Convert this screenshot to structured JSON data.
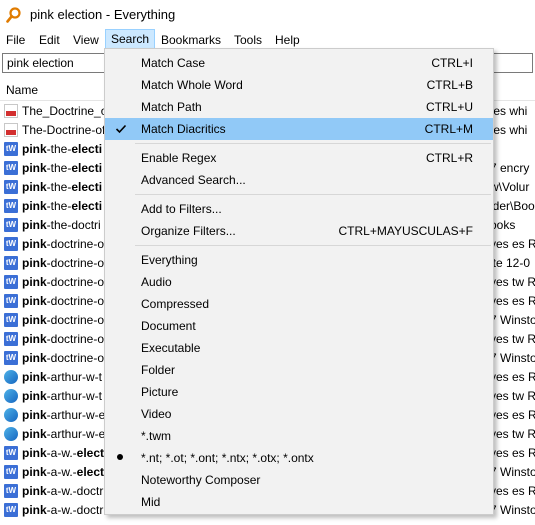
{
  "window": {
    "title": "pink election - Everything"
  },
  "menubar": [
    "File",
    "Edit",
    "View",
    "Search",
    "Bookmarks",
    "Tools",
    "Help"
  ],
  "search": {
    "value": "pink election"
  },
  "list": {
    "column_name": "Name",
    "rows": [
      {
        "icon": "pdf-icon",
        "bold": "",
        "rest": "The_Doctrine_of",
        "right": "tes whi"
      },
      {
        "icon": "pdf-icon",
        "bold": "",
        "rest": "The-Doctrine-of",
        "right": "tes whi"
      },
      {
        "icon": "tw-icon",
        "bold": "pink",
        "rest": "-the-",
        "bold2": "electi",
        "right": ""
      },
      {
        "icon": "tw-icon",
        "bold": "pink",
        "rest": "-the-",
        "bold2": "electi",
        "right": "7 encry"
      },
      {
        "icon": "tw-icon",
        "bold": "pink",
        "rest": "-the-",
        "bold2": "electi",
        "right": "w\\Volur"
      },
      {
        "icon": "tw-icon",
        "bold": "pink",
        "rest": "-the-",
        "bold2": "electi",
        "right": "lder\\Boo"
      },
      {
        "icon": "tw-icon",
        "bold": "pink",
        "rest": "-the-doctri",
        "bold2": "",
        "right": "ooks"
      },
      {
        "icon": "tw-icon",
        "bold": "pink",
        "rest": "-doctrine-o",
        "bold2": "",
        "right": "ves es R"
      },
      {
        "icon": "tw-icon",
        "bold": "pink",
        "rest": "-doctrine-o",
        "bold2": "",
        "right": "ite 12-0"
      },
      {
        "icon": "tw-icon",
        "bold": "pink",
        "rest": "-doctrine-o",
        "bold2": "",
        "right": "ves tw R"
      },
      {
        "icon": "tw-icon",
        "bold": "pink",
        "rest": "-doctrine-o",
        "bold2": "",
        "right": "ves es R"
      },
      {
        "icon": "tw-icon",
        "bold": "pink",
        "rest": "-doctrine-o",
        "bold2": "",
        "right": "7 Winsto"
      },
      {
        "icon": "tw-icon",
        "bold": "pink",
        "rest": "-doctrine-o",
        "bold2": "",
        "right": "ves tw R"
      },
      {
        "icon": "tw-icon",
        "bold": "pink",
        "rest": "-doctrine-o",
        "bold2": "",
        "right": "7 Winsto"
      },
      {
        "icon": "edge-icon",
        "bold": "pink",
        "rest": "-arthur-w-t",
        "bold2": "",
        "right": "ves es R"
      },
      {
        "icon": "edge-icon",
        "bold": "pink",
        "rest": "-arthur-w-t",
        "bold2": "",
        "right": "ves tw R"
      },
      {
        "icon": "edge-icon",
        "bold": "pink",
        "rest": "-arthur-w-e",
        "bold2": "",
        "right": "ves es R"
      },
      {
        "icon": "edge-icon",
        "bold": "pink",
        "rest": "-arthur-w-e",
        "bold2": "",
        "right": "ves tw R"
      },
      {
        "icon": "tw-icon",
        "bold": "pink",
        "rest": "-a-w.-",
        "bold2": "elect",
        "right": "ves es R"
      },
      {
        "icon": "tw-icon",
        "bold": "pink",
        "rest": "-a-w.-",
        "bold2": "elect",
        "right": "7 Winsto"
      },
      {
        "icon": "tw-icon",
        "bold": "pink",
        "rest": "-a-w.-doctr",
        "bold2": "",
        "right": "ves es R"
      },
      {
        "icon": "tw-icon",
        "bold": "pink",
        "rest": "-a-w.-doctr",
        "bold2": "",
        "right": "7 Winsto"
      }
    ]
  },
  "search_menu": {
    "items": [
      {
        "label": "Match Case",
        "shortcut": "CTRL+I",
        "mark": ""
      },
      {
        "label": "Match Whole Word",
        "shortcut": "CTRL+B",
        "mark": ""
      },
      {
        "label": "Match Path",
        "shortcut": "CTRL+U",
        "mark": ""
      },
      {
        "label": "Match Diacritics",
        "shortcut": "CTRL+M",
        "mark": "check"
      },
      {
        "label": "Enable Regex",
        "shortcut": "CTRL+R",
        "mark": ""
      },
      {
        "label": "Advanced Search...",
        "shortcut": "",
        "mark": ""
      },
      {
        "label": "Add to Filters...",
        "shortcut": "",
        "mark": ""
      },
      {
        "label": "Organize Filters...",
        "shortcut": "CTRL+MAYUSCULAS+F",
        "mark": ""
      },
      {
        "label": "Everything",
        "shortcut": "",
        "mark": ""
      },
      {
        "label": "Audio",
        "shortcut": "",
        "mark": ""
      },
      {
        "label": "Compressed",
        "shortcut": "",
        "mark": ""
      },
      {
        "label": "Document",
        "shortcut": "",
        "mark": ""
      },
      {
        "label": "Executable",
        "shortcut": "",
        "mark": ""
      },
      {
        "label": "Folder",
        "shortcut": "",
        "mark": ""
      },
      {
        "label": "Picture",
        "shortcut": "",
        "mark": ""
      },
      {
        "label": "Video",
        "shortcut": "",
        "mark": ""
      },
      {
        "label": "*.twm",
        "shortcut": "",
        "mark": ""
      },
      {
        "label": "*.nt; *.ot; *.ont; *.ntx; *.otx; *.ontx",
        "shortcut": "",
        "mark": "bullet"
      },
      {
        "label": "Noteworthy Composer",
        "shortcut": "",
        "mark": ""
      },
      {
        "label": "Mid",
        "shortcut": "",
        "mark": ""
      }
    ],
    "hover_index": 3
  }
}
